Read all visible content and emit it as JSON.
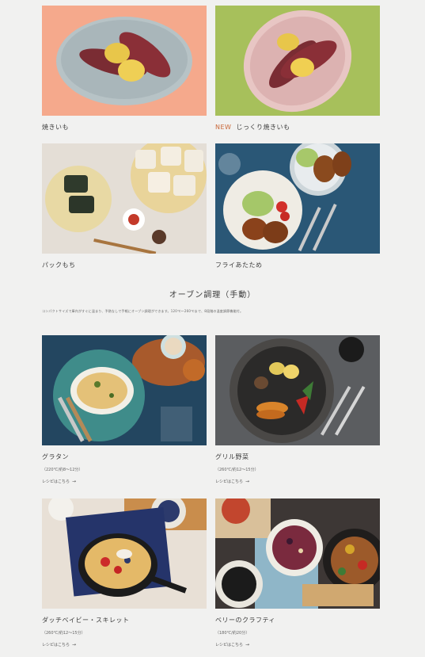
{
  "top_items": [
    {
      "label": "焼きいも",
      "badge": ""
    },
    {
      "label": "じっくり焼きいも",
      "badge": "NEW"
    },
    {
      "label": "パックもち",
      "badge": ""
    },
    {
      "label": "フライあたため",
      "badge": ""
    }
  ],
  "section": {
    "title": "オーブン調理（手動）",
    "description": "コンパクトサイズで庫内がすぐに温まり、予熱なしで手軽にオーブン調理ができます。120℃〜260℃まで、8段階の温度調節機能付。"
  },
  "recipes": [
    {
      "label": "グラタン",
      "detail": "（220℃/約8〜12分）",
      "link": "レシピはこちら"
    },
    {
      "label": "グリル野菜",
      "detail": "（260℃/約12〜15分）",
      "link": "レシピはこちら"
    },
    {
      "label": "ダッチベイビー・スキレット",
      "detail": "（260℃/約12〜15分）",
      "link": "レシピはこちら"
    },
    {
      "label": "ベリーのクラフティ",
      "detail": "（180℃/約20分）",
      "link": "レシピはこちら"
    }
  ],
  "colors": {
    "bg": "#f1f1f0",
    "new_badge": "#c9683a"
  }
}
